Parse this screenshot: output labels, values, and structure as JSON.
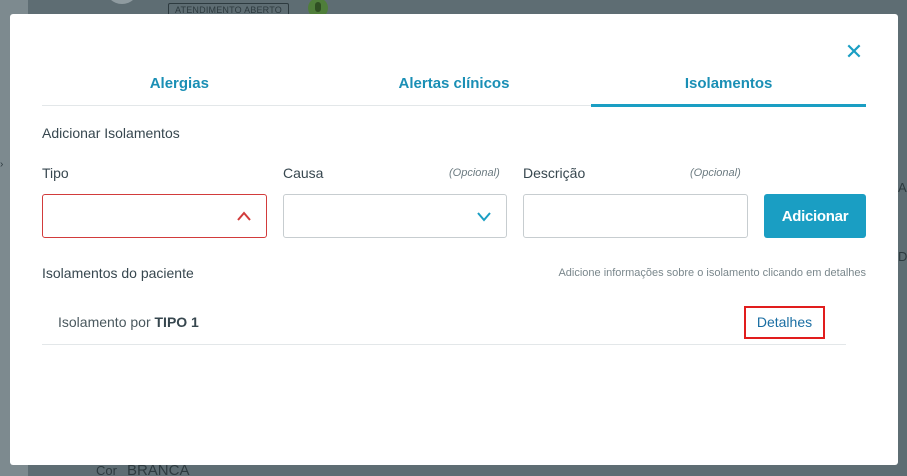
{
  "background": {
    "badge": "ATENDIMENTO ABERTO",
    "bottom_label": "Cor",
    "bottom_value": "BRANCA",
    "right_letter_1": "A",
    "right_letter_2": "D"
  },
  "modal": {
    "close_icon": "close-icon",
    "tabs": [
      {
        "label": "Alergias",
        "active": false
      },
      {
        "label": "Alertas clínicos",
        "active": false
      },
      {
        "label": "Isolamentos",
        "active": true
      }
    ],
    "section_title": "Adicionar Isolamentos",
    "fields": {
      "tipo": {
        "label": "Tipo",
        "value": "",
        "invalid": true
      },
      "causa": {
        "label": "Causa",
        "optional": "(Opcional)",
        "value": ""
      },
      "descricao": {
        "label": "Descrição",
        "optional": "(Opcional)",
        "value": ""
      }
    },
    "add_button": "Adicionar",
    "list_title": "Isolamentos do paciente",
    "hint": "Adicione informações sobre o isolamento clicando em detalhes",
    "items": [
      {
        "prefix": "Isolamento por",
        "type": "TIPO 1",
        "details_label": "Detalhes"
      }
    ]
  },
  "colors": {
    "accent": "#1a9ec3",
    "error": "#d23b3b",
    "highlight": "#e11d1d"
  }
}
